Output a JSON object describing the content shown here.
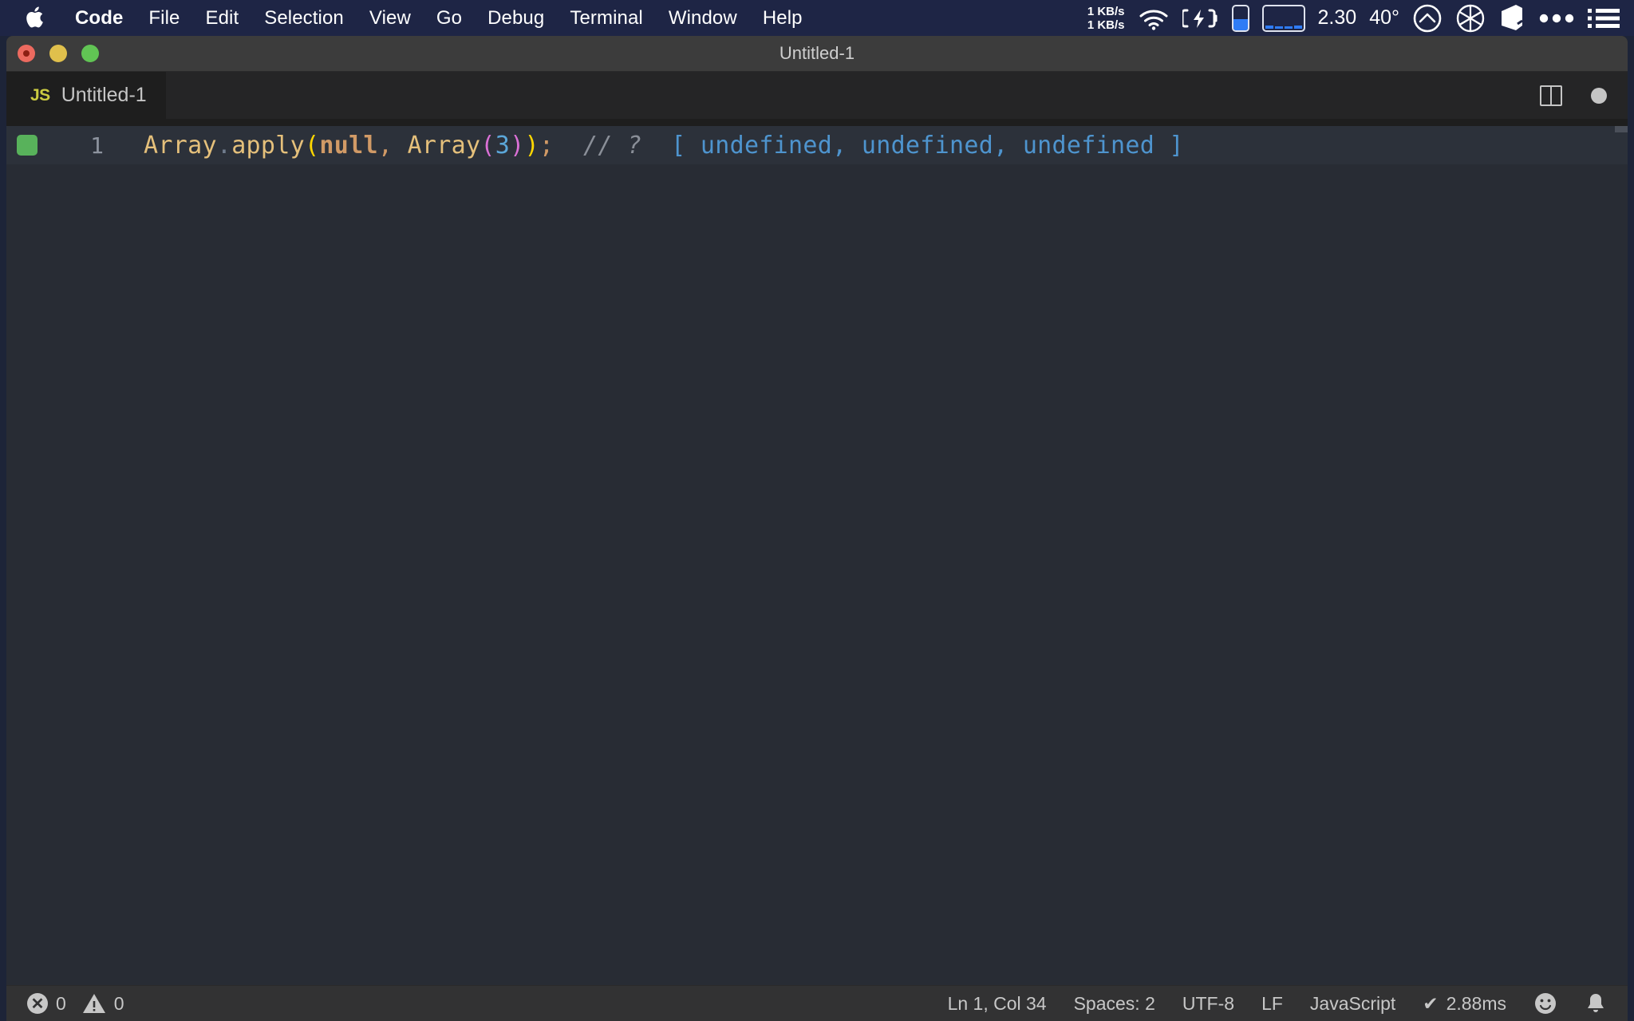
{
  "menubar": {
    "apple_icon": "apple-logo-icon",
    "items": [
      {
        "label": "Code",
        "bold": true
      },
      {
        "label": "File",
        "bold": false
      },
      {
        "label": "Edit",
        "bold": false
      },
      {
        "label": "Selection",
        "bold": false
      },
      {
        "label": "View",
        "bold": false
      },
      {
        "label": "Go",
        "bold": false
      },
      {
        "label": "Debug",
        "bold": false
      },
      {
        "label": "Terminal",
        "bold": false
      },
      {
        "label": "Window",
        "bold": false
      },
      {
        "label": "Help",
        "bold": false
      }
    ],
    "status": {
      "net_down": "1 KB/s",
      "net_up": "1 KB/s",
      "wifi_icon": "wifi-icon",
      "battery_charging_icon": "battery-charging-icon",
      "battery_level_icon": "battery-level-icon",
      "cpu_meter_icon": "cpu-meter-icon",
      "load_value": "2.30",
      "temperature": "40°",
      "up_arrow_circle_icon": "upload-circle-icon",
      "aperture_icon": "aperture-icon",
      "cube_icon": "cube-icon",
      "ellipsis_icon": "ellipsis-icon",
      "menu_list_icon": "menu-list-icon"
    },
    "colors": {
      "background": "#1e2545",
      "accent_blue": "#2f7cf6",
      "text": "#ffffff"
    }
  },
  "window": {
    "title": "Untitled-1",
    "traffic_lights": [
      {
        "name": "close",
        "color": "#ec6a5f"
      },
      {
        "name": "minimize",
        "color": "#e0c04c"
      },
      {
        "name": "zoom",
        "color": "#61c454"
      }
    ]
  },
  "tabbar": {
    "tabs": [
      {
        "badge": "JS",
        "label": "Untitled-1",
        "active": true,
        "dirty": true
      }
    ],
    "actions": {
      "split_editor_icon": "split-editor-icon",
      "unsaved_dot_icon": "unsaved-dot-icon"
    },
    "badge_color": "#cbcb41"
  },
  "editor": {
    "language": "JavaScript",
    "breakpoint_marker": "quokka-live-green-square",
    "line_number": "1",
    "code_tokens": [
      {
        "text": "Array",
        "type": "identifier",
        "color": "#e5c07b"
      },
      {
        "text": ".",
        "type": "punctuation",
        "color": "#6f7b8c"
      },
      {
        "text": "apply",
        "type": "identifier",
        "color": "#e5c07b"
      },
      {
        "text": "(",
        "type": "bracket-level-1",
        "color": "#ffd700"
      },
      {
        "text": "null",
        "type": "keyword",
        "color": "#d19a66"
      },
      {
        "text": ", ",
        "type": "punctuation",
        "color": "#d19a66"
      },
      {
        "text": "Array",
        "type": "identifier",
        "color": "#e5c07b"
      },
      {
        "text": "(",
        "type": "bracket-level-2",
        "color": "#da70d6"
      },
      {
        "text": "3",
        "type": "number",
        "color": "#5ba7d9"
      },
      {
        "text": ")",
        "type": "bracket-level-2",
        "color": "#da70d6"
      },
      {
        "text": ")",
        "type": "bracket-level-1",
        "color": "#ffd700"
      },
      {
        "text": ";",
        "type": "punctuation",
        "color": "#d19a66"
      },
      {
        "text": "  // ?",
        "type": "comment",
        "color": "#8a8f98"
      },
      {
        "text": "  [ undefined, undefined, undefined ]",
        "type": "inline-value",
        "color": "#4e94ce"
      }
    ],
    "code_plain": "Array.apply(null, Array(3));  // ?  [ undefined, undefined, undefined ]",
    "background": "#282c34",
    "active_line_background": "#2c313a"
  },
  "statusbar": {
    "errors_icon": "error-circle-icon",
    "errors_count": "0",
    "warnings_icon": "warning-triangle-icon",
    "warnings_count": "0",
    "cursor_position": "Ln 1, Col 34",
    "indentation": "Spaces: 2",
    "encoding": "UTF-8",
    "eol": "LF",
    "language_mode": "JavaScript",
    "run_check_icon": "check-icon",
    "run_time": "2.88ms",
    "feedback_icon": "smiley-icon",
    "notifications_icon": "bell-icon",
    "background": "#323233"
  }
}
